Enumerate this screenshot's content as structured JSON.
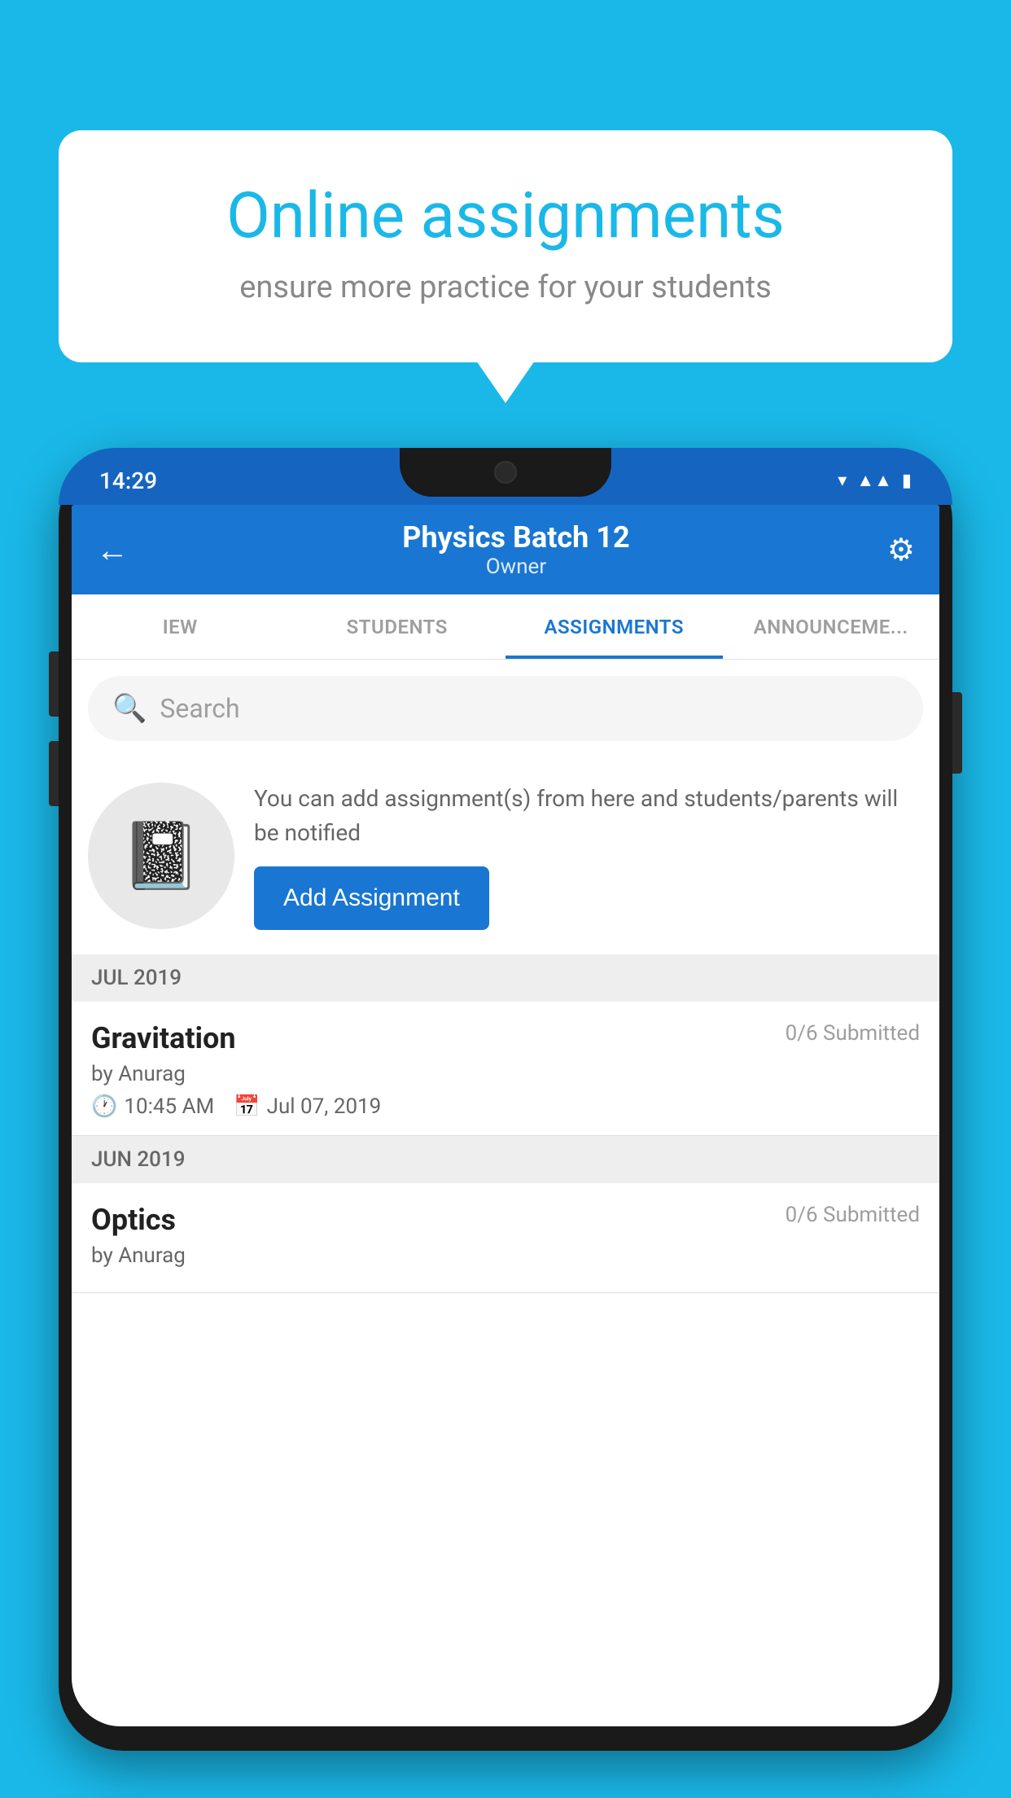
{
  "background_color": "#1ab8e8",
  "speech_bubble": {
    "title": "Online assignments",
    "subtitle": "ensure more practice for your students"
  },
  "status_bar": {
    "time": "14:29",
    "wifi_icon": "▾",
    "signal_icon": "▴▴",
    "battery_icon": "▮"
  },
  "header": {
    "title": "Physics Batch 12",
    "subtitle": "Owner",
    "back_label": "←",
    "settings_label": "⚙"
  },
  "tabs": [
    {
      "label": "IEW",
      "active": false
    },
    {
      "label": "STUDENTS",
      "active": false
    },
    {
      "label": "ASSIGNMENTS",
      "active": true
    },
    {
      "label": "ANNOUNCEME...",
      "active": false
    }
  ],
  "search": {
    "placeholder": "Search"
  },
  "info_card": {
    "description": "You can add assignment(s) from here and students/parents will be notified",
    "button_label": "Add Assignment"
  },
  "sections": [
    {
      "label": "JUL 2019",
      "assignments": [
        {
          "title": "Gravitation",
          "status": "0/6 Submitted",
          "author": "by Anurag",
          "time": "10:45 AM",
          "date": "Jul 07, 2019"
        }
      ]
    },
    {
      "label": "JUN 2019",
      "assignments": [
        {
          "title": "Optics",
          "status": "0/6 Submitted",
          "author": "by Anurag",
          "time": "",
          "date": ""
        }
      ]
    }
  ]
}
